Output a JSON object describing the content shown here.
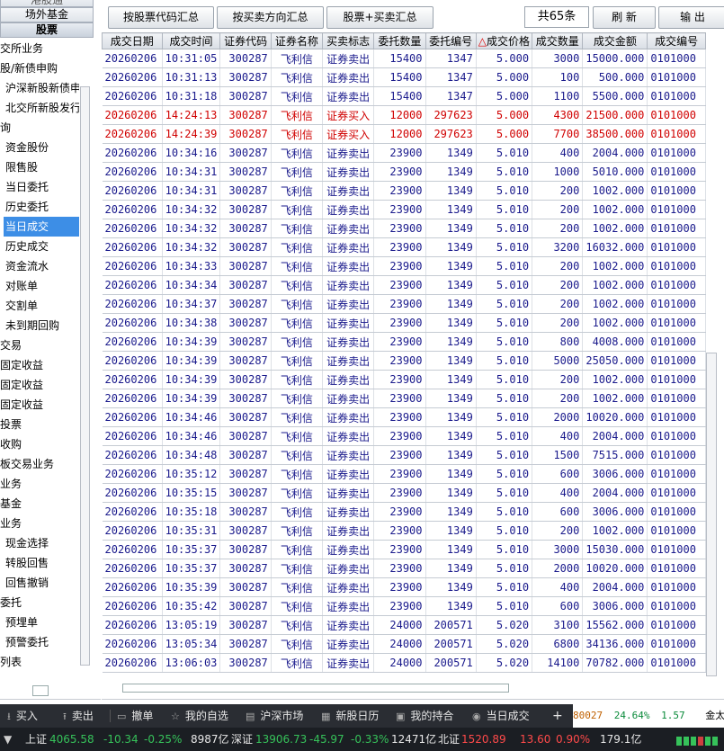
{
  "sidebar": {
    "top_tabs": [
      "港股通",
      "场外基金",
      "股票"
    ],
    "items": [
      {
        "label": "交所业务",
        "type": "root"
      },
      {
        "label": "股/新债申购",
        "type": "root"
      },
      {
        "label": "沪深新股新债申",
        "type": "sub"
      },
      {
        "label": "北交所新股发行",
        "type": "sub"
      },
      {
        "label": "询",
        "type": "root"
      },
      {
        "label": "资金股份",
        "type": "sub"
      },
      {
        "label": "限售股",
        "type": "sub"
      },
      {
        "label": "当日委托",
        "type": "sub"
      },
      {
        "label": "历史委托",
        "type": "sub"
      },
      {
        "label": "当日成交",
        "type": "sub",
        "selected": true
      },
      {
        "label": "历史成交",
        "type": "sub"
      },
      {
        "label": "资金流水",
        "type": "sub"
      },
      {
        "label": "对账单",
        "type": "sub"
      },
      {
        "label": "交割单",
        "type": "sub"
      },
      {
        "label": "未到期回购",
        "type": "sub"
      },
      {
        "label": "交易",
        "type": "root"
      },
      {
        "label": "固定收益",
        "type": "root"
      },
      {
        "label": "固定收益",
        "type": "root"
      },
      {
        "label": "固定收益",
        "type": "root"
      },
      {
        "label": "投票",
        "type": "root"
      },
      {
        "label": "收购",
        "type": "root"
      },
      {
        "label": "板交易业务",
        "type": "root"
      },
      {
        "label": "业务",
        "type": "root"
      },
      {
        "label": "基金",
        "type": "root"
      },
      {
        "label": "业务",
        "type": "root"
      },
      {
        "label": "现金选择",
        "type": "sub"
      },
      {
        "label": "转股回售",
        "type": "sub"
      },
      {
        "label": "回售撤销",
        "type": "sub"
      },
      {
        "label": "委托",
        "type": "root"
      },
      {
        "label": "预埋单",
        "type": "sub"
      },
      {
        "label": "预警委托",
        "type": "sub"
      },
      {
        "label": "列表",
        "type": "root"
      }
    ]
  },
  "toolbar": {
    "by_code_label": "按股票代码汇总",
    "by_direction_label": "按买卖方向汇总",
    "stock_direction_label": "股票+买卖汇总",
    "count_label": "共65条",
    "refresh_label": "刷 新",
    "export_label": "输 出"
  },
  "table": {
    "columns": [
      "成交日期",
      "成交时间",
      "证券代码",
      "证券名称",
      "买卖标志",
      "委托数量",
      "委托编号",
      "成交价格",
      "成交数量",
      "成交金额",
      "成交编号"
    ],
    "sort_marker": "△",
    "rows": [
      [
        "20260206",
        "10:31:05",
        "300287",
        "飞利信",
        "证券卖出",
        "15400",
        "1347",
        "5.000",
        "3000",
        "15000.000",
        "0101000"
      ],
      [
        "20260206",
        "10:31:13",
        "300287",
        "飞利信",
        "证券卖出",
        "15400",
        "1347",
        "5.000",
        "100",
        "500.000",
        "0101000"
      ],
      [
        "20260206",
        "10:31:18",
        "300287",
        "飞利信",
        "证券卖出",
        "15400",
        "1347",
        "5.000",
        "1100",
        "5500.000",
        "0101000"
      ],
      [
        "20260206",
        "14:24:13",
        "300287",
        "飞利信",
        "证券买入",
        "12000",
        "297623",
        "5.000",
        "4300",
        "21500.000",
        "0101000"
      ],
      [
        "20260206",
        "14:24:39",
        "300287",
        "飞利信",
        "证券买入",
        "12000",
        "297623",
        "5.000",
        "7700",
        "38500.000",
        "0101000"
      ],
      [
        "20260206",
        "10:34:16",
        "300287",
        "飞利信",
        "证券卖出",
        "23900",
        "1349",
        "5.010",
        "400",
        "2004.000",
        "0101000"
      ],
      [
        "20260206",
        "10:34:31",
        "300287",
        "飞利信",
        "证券卖出",
        "23900",
        "1349",
        "5.010",
        "1000",
        "5010.000",
        "0101000"
      ],
      [
        "20260206",
        "10:34:31",
        "300287",
        "飞利信",
        "证券卖出",
        "23900",
        "1349",
        "5.010",
        "200",
        "1002.000",
        "0101000"
      ],
      [
        "20260206",
        "10:34:32",
        "300287",
        "飞利信",
        "证券卖出",
        "23900",
        "1349",
        "5.010",
        "200",
        "1002.000",
        "0101000"
      ],
      [
        "20260206",
        "10:34:32",
        "300287",
        "飞利信",
        "证券卖出",
        "23900",
        "1349",
        "5.010",
        "200",
        "1002.000",
        "0101000"
      ],
      [
        "20260206",
        "10:34:32",
        "300287",
        "飞利信",
        "证券卖出",
        "23900",
        "1349",
        "5.010",
        "3200",
        "16032.000",
        "0101000"
      ],
      [
        "20260206",
        "10:34:33",
        "300287",
        "飞利信",
        "证券卖出",
        "23900",
        "1349",
        "5.010",
        "200",
        "1002.000",
        "0101000"
      ],
      [
        "20260206",
        "10:34:34",
        "300287",
        "飞利信",
        "证券卖出",
        "23900",
        "1349",
        "5.010",
        "200",
        "1002.000",
        "0101000"
      ],
      [
        "20260206",
        "10:34:37",
        "300287",
        "飞利信",
        "证券卖出",
        "23900",
        "1349",
        "5.010",
        "200",
        "1002.000",
        "0101000"
      ],
      [
        "20260206",
        "10:34:38",
        "300287",
        "飞利信",
        "证券卖出",
        "23900",
        "1349",
        "5.010",
        "200",
        "1002.000",
        "0101000"
      ],
      [
        "20260206",
        "10:34:39",
        "300287",
        "飞利信",
        "证券卖出",
        "23900",
        "1349",
        "5.010",
        "800",
        "4008.000",
        "0101000"
      ],
      [
        "20260206",
        "10:34:39",
        "300287",
        "飞利信",
        "证券卖出",
        "23900",
        "1349",
        "5.010",
        "5000",
        "25050.000",
        "0101000"
      ],
      [
        "20260206",
        "10:34:39",
        "300287",
        "飞利信",
        "证券卖出",
        "23900",
        "1349",
        "5.010",
        "200",
        "1002.000",
        "0101000"
      ],
      [
        "20260206",
        "10:34:39",
        "300287",
        "飞利信",
        "证券卖出",
        "23900",
        "1349",
        "5.010",
        "200",
        "1002.000",
        "0101000"
      ],
      [
        "20260206",
        "10:34:46",
        "300287",
        "飞利信",
        "证券卖出",
        "23900",
        "1349",
        "5.010",
        "2000",
        "10020.000",
        "0101000"
      ],
      [
        "20260206",
        "10:34:46",
        "300287",
        "飞利信",
        "证券卖出",
        "23900",
        "1349",
        "5.010",
        "400",
        "2004.000",
        "0101000"
      ],
      [
        "20260206",
        "10:34:48",
        "300287",
        "飞利信",
        "证券卖出",
        "23900",
        "1349",
        "5.010",
        "1500",
        "7515.000",
        "0101000"
      ],
      [
        "20260206",
        "10:35:12",
        "300287",
        "飞利信",
        "证券卖出",
        "23900",
        "1349",
        "5.010",
        "600",
        "3006.000",
        "0101000"
      ],
      [
        "20260206",
        "10:35:15",
        "300287",
        "飞利信",
        "证券卖出",
        "23900",
        "1349",
        "5.010",
        "400",
        "2004.000",
        "0101000"
      ],
      [
        "20260206",
        "10:35:18",
        "300287",
        "飞利信",
        "证券卖出",
        "23900",
        "1349",
        "5.010",
        "600",
        "3006.000",
        "0101000"
      ],
      [
        "20260206",
        "10:35:31",
        "300287",
        "飞利信",
        "证券卖出",
        "23900",
        "1349",
        "5.010",
        "200",
        "1002.000",
        "0101000"
      ],
      [
        "20260206",
        "10:35:37",
        "300287",
        "飞利信",
        "证券卖出",
        "23900",
        "1349",
        "5.010",
        "3000",
        "15030.000",
        "0101000"
      ],
      [
        "20260206",
        "10:35:37",
        "300287",
        "飞利信",
        "证券卖出",
        "23900",
        "1349",
        "5.010",
        "2000",
        "10020.000",
        "0101000"
      ],
      [
        "20260206",
        "10:35:39",
        "300287",
        "飞利信",
        "证券卖出",
        "23900",
        "1349",
        "5.010",
        "400",
        "2004.000",
        "0101000"
      ],
      [
        "20260206",
        "10:35:42",
        "300287",
        "飞利信",
        "证券卖出",
        "23900",
        "1349",
        "5.010",
        "600",
        "3006.000",
        "0101000"
      ],
      [
        "20260206",
        "13:05:19",
        "300287",
        "飞利信",
        "证券卖出",
        "24000",
        "200571",
        "5.020",
        "3100",
        "15562.000",
        "0101000"
      ],
      [
        "20260206",
        "13:05:34",
        "300287",
        "飞利信",
        "证券卖出",
        "24000",
        "200571",
        "5.020",
        "6800",
        "34136.000",
        "0101000"
      ],
      [
        "20260206",
        "13:06:03",
        "300287",
        "飞利信",
        "证券卖出",
        "24000",
        "200571",
        "5.020",
        "14100",
        "70782.000",
        "0101000"
      ]
    ],
    "buy_flag": "证券买入"
  },
  "actionbar": {
    "buy": "买入",
    "sell": "卖出",
    "cancel": "撤单",
    "watchlist": "我的自选",
    "market": "沪深市场",
    "ipo_calendar": "新股日历",
    "holdings": "我的持合",
    "today_deals": "当日成交",
    "add": "+",
    "ticker_code": "80027",
    "ticker_pct": "24.64%",
    "ticker_val": "1.57",
    "ticker_name": "金太"
  },
  "statusbar": {
    "sh_label": "上证",
    "sh_index": "4065.58",
    "sh_change": "-10.34",
    "sh_pct": "-0.25%",
    "sh_amount": "8987亿",
    "sz_label": "深证",
    "sz_index": "13906.73",
    "sz_change": "-45.97",
    "sz_pct": "-0.33%",
    "sz_amount": "12471亿",
    "bj_label": "北证",
    "bj_index": "1520.89",
    "bj_change": "13.60",
    "bj_pct": "0.90%",
    "bj_amount": "179.1亿"
  },
  "colors": {
    "sell_text": "#1a1a8c",
    "buy_text": "#d00000",
    "selected_menu": "#3d8ee6",
    "up": "#ff4a4a",
    "down": "#36c25a"
  }
}
